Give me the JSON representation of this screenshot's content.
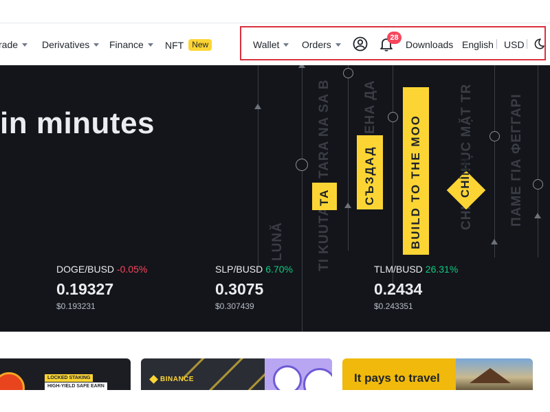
{
  "nav": {
    "trade_label": "rade",
    "derivatives_label": "Derivatives",
    "finance_label": "Finance",
    "nft_label": "NFT",
    "nft_badge": "New",
    "wallet_label": "Wallet",
    "orders_label": "Orders",
    "notification_count": "28",
    "downloads_label": "Downloads",
    "language_label": "English",
    "currency_label": "USD"
  },
  "hero": {
    "title": "in minutes",
    "vertical_texts": [
      "TARA NA SA B",
      "СЪЗДАД",
      "ЕНА ДА",
      "BUILD TO THE MOO",
      "CHINH PHỤC MẶT TR",
      "ΠΑΜΕ ΓΙΑ ΦΕΓΓΑΡΙ",
      "LUNĂ",
      "TI KUUTA",
      "TA",
      "CHÍNH"
    ],
    "tickers": [
      {
        "pair": "DOGE/BUSD",
        "change": "-0.05%",
        "price": "0.19327",
        "usd": "$0.193231",
        "direction": "neg"
      },
      {
        "pair": "SLP/BUSD",
        "change": "6.70%",
        "price": "0.3075",
        "usd": "$0.307439",
        "direction": "pos"
      },
      {
        "pair": "TLM/BUSD",
        "change": "26.31%",
        "price": "0.2434",
        "usd": "$0.243351",
        "direction": "pos"
      }
    ]
  },
  "cards": {
    "card1_tag": "LOCKED STAKING",
    "card1_sub": "HIGH-YIELD SAFE EARN",
    "card2_logo": "BINANCE",
    "card3_title": "It pays to travel"
  },
  "colors": {
    "brand_yellow": "#fcd535",
    "hero_bg": "#14151a",
    "negative": "#f6465d",
    "positive": "#0ecb81",
    "highlight_border": "#d9303e"
  }
}
